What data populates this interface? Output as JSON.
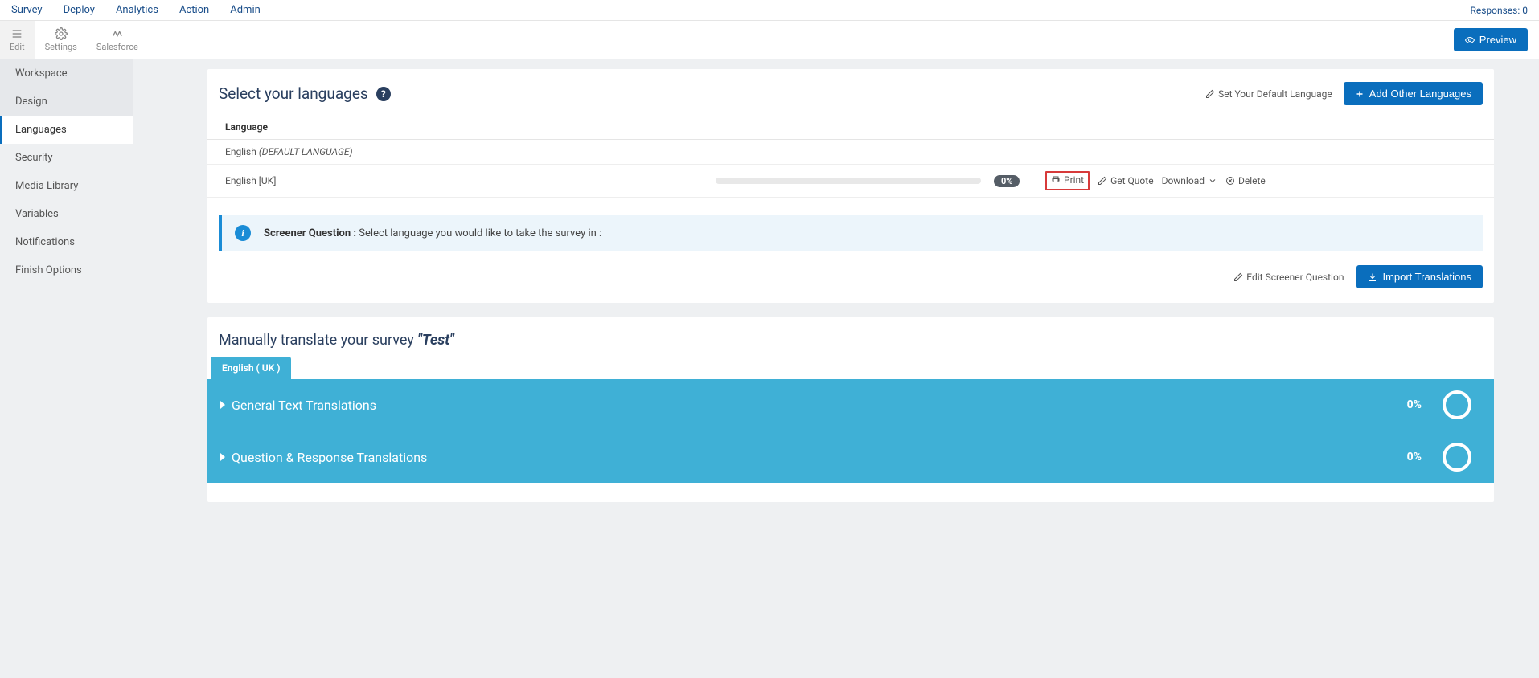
{
  "topnav": {
    "items": [
      "Survey",
      "Deploy",
      "Analytics",
      "Action",
      "Admin"
    ],
    "active": "Survey",
    "responses_label": "Responses: 0"
  },
  "toolbar": {
    "edit": "Edit",
    "settings": "Settings",
    "salesforce": "Salesforce",
    "preview": "Preview"
  },
  "sidebar": {
    "items": [
      {
        "label": "Workspace",
        "active": false
      },
      {
        "label": "Design",
        "active": false
      },
      {
        "label": "Languages",
        "active": true
      },
      {
        "label": "Security",
        "active": false
      },
      {
        "label": "Media Library",
        "active": false
      },
      {
        "label": "Variables",
        "active": false
      },
      {
        "label": "Notifications",
        "active": false
      },
      {
        "label": "Finish Options",
        "active": false
      }
    ]
  },
  "languages_section": {
    "title": "Select your languages",
    "set_default_label": "Set Your Default Language",
    "add_other_label": "Add Other Languages",
    "column_header": "Language",
    "default_row": {
      "name": "English",
      "badge": "(DEFAULT LANGUAGE)"
    },
    "rows": [
      {
        "name": "English [UK]",
        "percent": "0%",
        "actions": {
          "print": "Print",
          "get_quote": "Get Quote",
          "download": "Download",
          "delete": "Delete"
        }
      }
    ]
  },
  "screener": {
    "label": "Screener Question :",
    "text": "Select language you would like to take the survey in :",
    "edit_label": "Edit Screener Question",
    "import_label": "Import Translations"
  },
  "translate_section": {
    "prefix": "Manually translate your survey ",
    "survey_name": "\"Test\"",
    "tab_label": "English ( UK )",
    "accordion": [
      {
        "title": "General Text Translations",
        "percent": "0%"
      },
      {
        "title": "Question & Response Translations",
        "percent": "0%"
      }
    ]
  }
}
